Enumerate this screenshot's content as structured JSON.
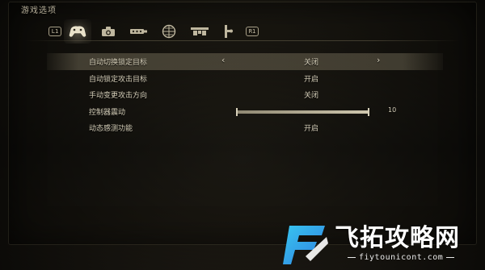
{
  "menu": {
    "title": "游戏选项"
  },
  "tabs": [
    {
      "name": "left-bumper",
      "label": "L1"
    },
    {
      "name": "game-options",
      "icon": "gamepad-icon",
      "active": true
    },
    {
      "name": "camera",
      "icon": "camera-icon"
    },
    {
      "name": "display",
      "icon": "display-icon"
    },
    {
      "name": "sound",
      "icon": "speaker-grid-icon"
    },
    {
      "name": "network",
      "icon": "network-icon"
    },
    {
      "name": "controls",
      "icon": "controller-stick-icon"
    },
    {
      "name": "right-bumper",
      "label": "R1"
    }
  ],
  "options": [
    {
      "label": "自动切换锁定目标",
      "value": "关闭",
      "selected": true,
      "has_arrows": true
    },
    {
      "label": "自动锁定攻击目标",
      "value": "开启"
    },
    {
      "label": "手动变更攻击方向",
      "value": "关闭"
    },
    {
      "label": "控制器震动",
      "value": "10",
      "slider_level": 1.0,
      "slider_max": 10
    },
    {
      "label": "动态感测功能",
      "value": "开启"
    }
  ],
  "arrows": {
    "left": "‹",
    "right": "›"
  },
  "watermark": {
    "title": "飞拓攻略网",
    "url": "fiytounicont.com"
  },
  "colors": {
    "text": "#d6cfb9",
    "highlight": "#aaa082",
    "watermark_blue": "#2f7fe0",
    "watermark_cyan": "#38c6f0"
  }
}
